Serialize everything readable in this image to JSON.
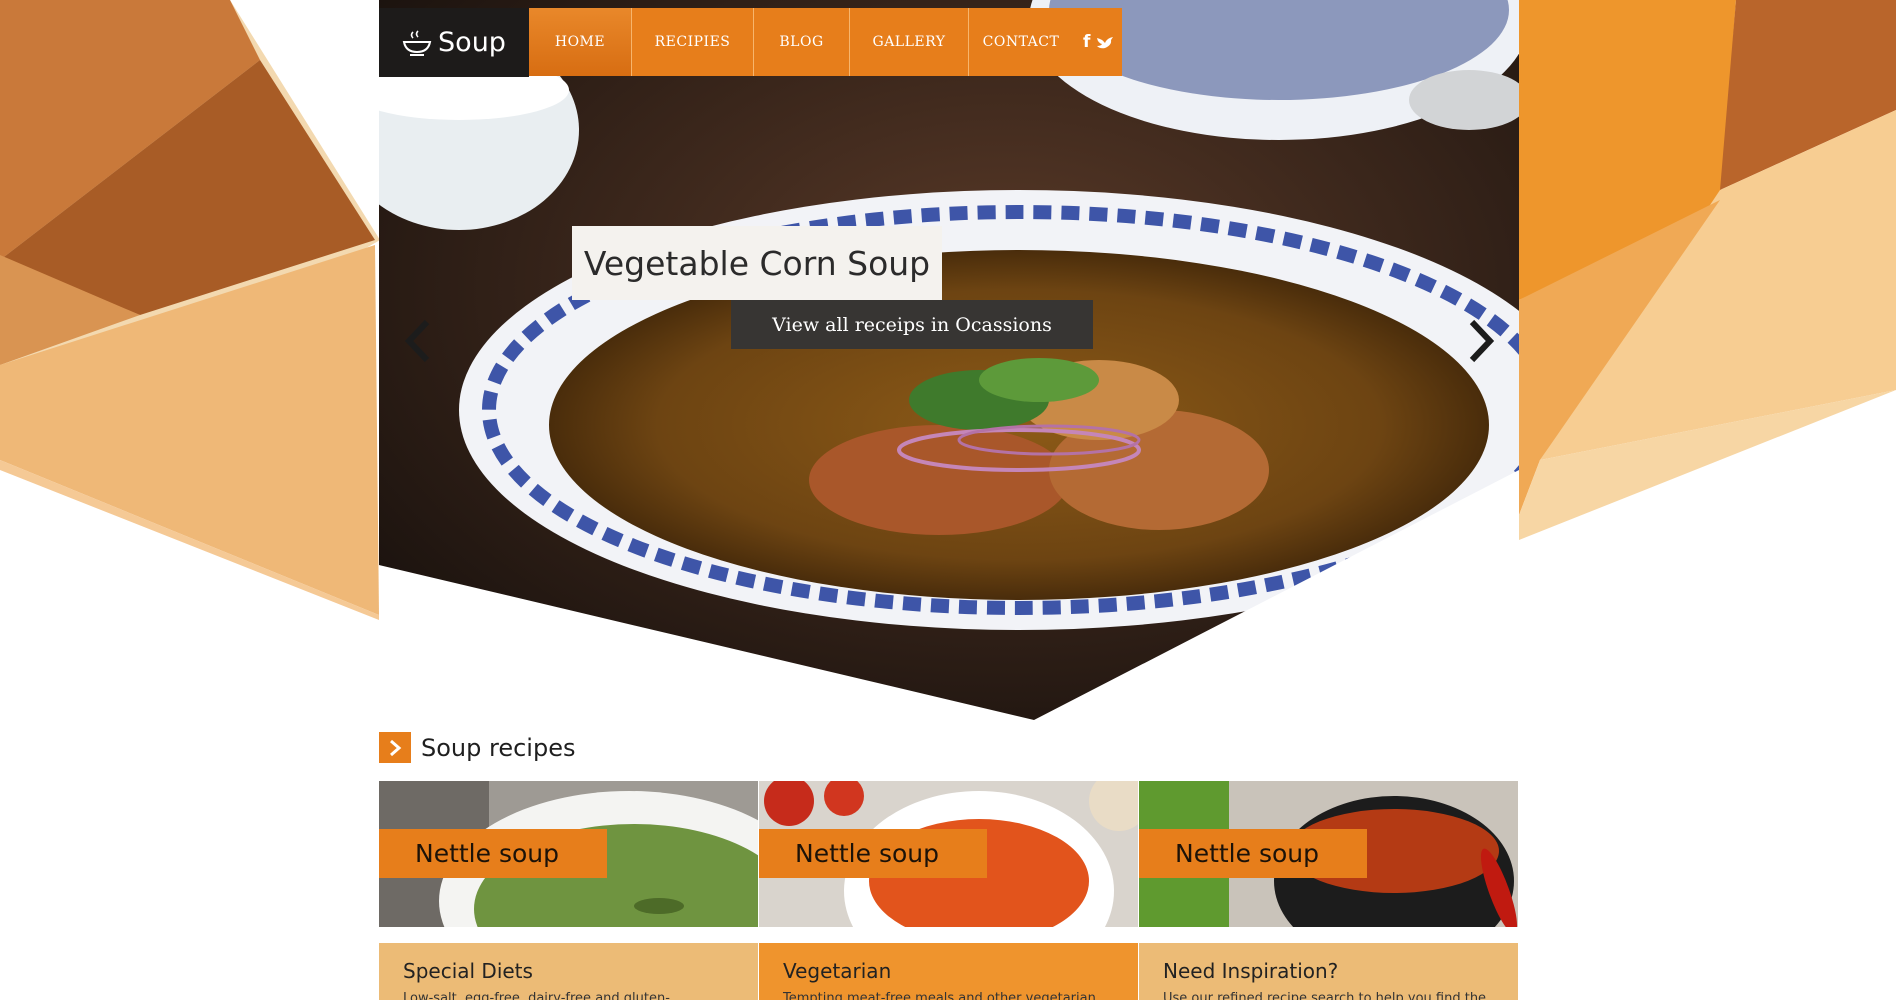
{
  "brand": {
    "name": "Soup"
  },
  "nav": {
    "items": [
      {
        "label": "HOME",
        "active": true
      },
      {
        "label": "RECIPIES",
        "active": false
      },
      {
        "label": "BLOG",
        "active": false
      },
      {
        "label": "GALLERY",
        "active": false
      },
      {
        "label": "CONTACT",
        "active": false
      }
    ],
    "social": {
      "facebook": "f"
    }
  },
  "hero": {
    "title": "Vegetable Corn Soup",
    "link_label": "View all receips in Ocassions"
  },
  "recipes": {
    "heading": "Soup recipes",
    "cards": [
      {
        "label": "Nettle soup",
        "soup_color": "#6f9440"
      },
      {
        "label": "Nettle soup",
        "soup_color": "#e2541c"
      },
      {
        "label": "Nettle soup",
        "soup_color": "#b43a14"
      }
    ]
  },
  "features": [
    {
      "title": "Special Diets",
      "text": "Low-salt, egg-free, dairy-free and gluten-"
    },
    {
      "title": "Vegetarian",
      "text": "Tempting meat-free meals and other vegetarian"
    },
    {
      "title": "Need Inspiration?",
      "text": "Use our refined recipe search to help you find the"
    }
  ],
  "colors": {
    "accent": "#e77e1b",
    "dark": "#1d1b1a",
    "feature_light": "#ecbb76",
    "feature_dark": "#ef942d"
  },
  "icons": {
    "logo": "soup-bowl-icon",
    "facebook": "facebook-icon",
    "twitter": "twitter-bird-icon",
    "prev": "chevron-left-icon",
    "next": "chevron-right-icon",
    "section": "chevron-right-icon"
  }
}
